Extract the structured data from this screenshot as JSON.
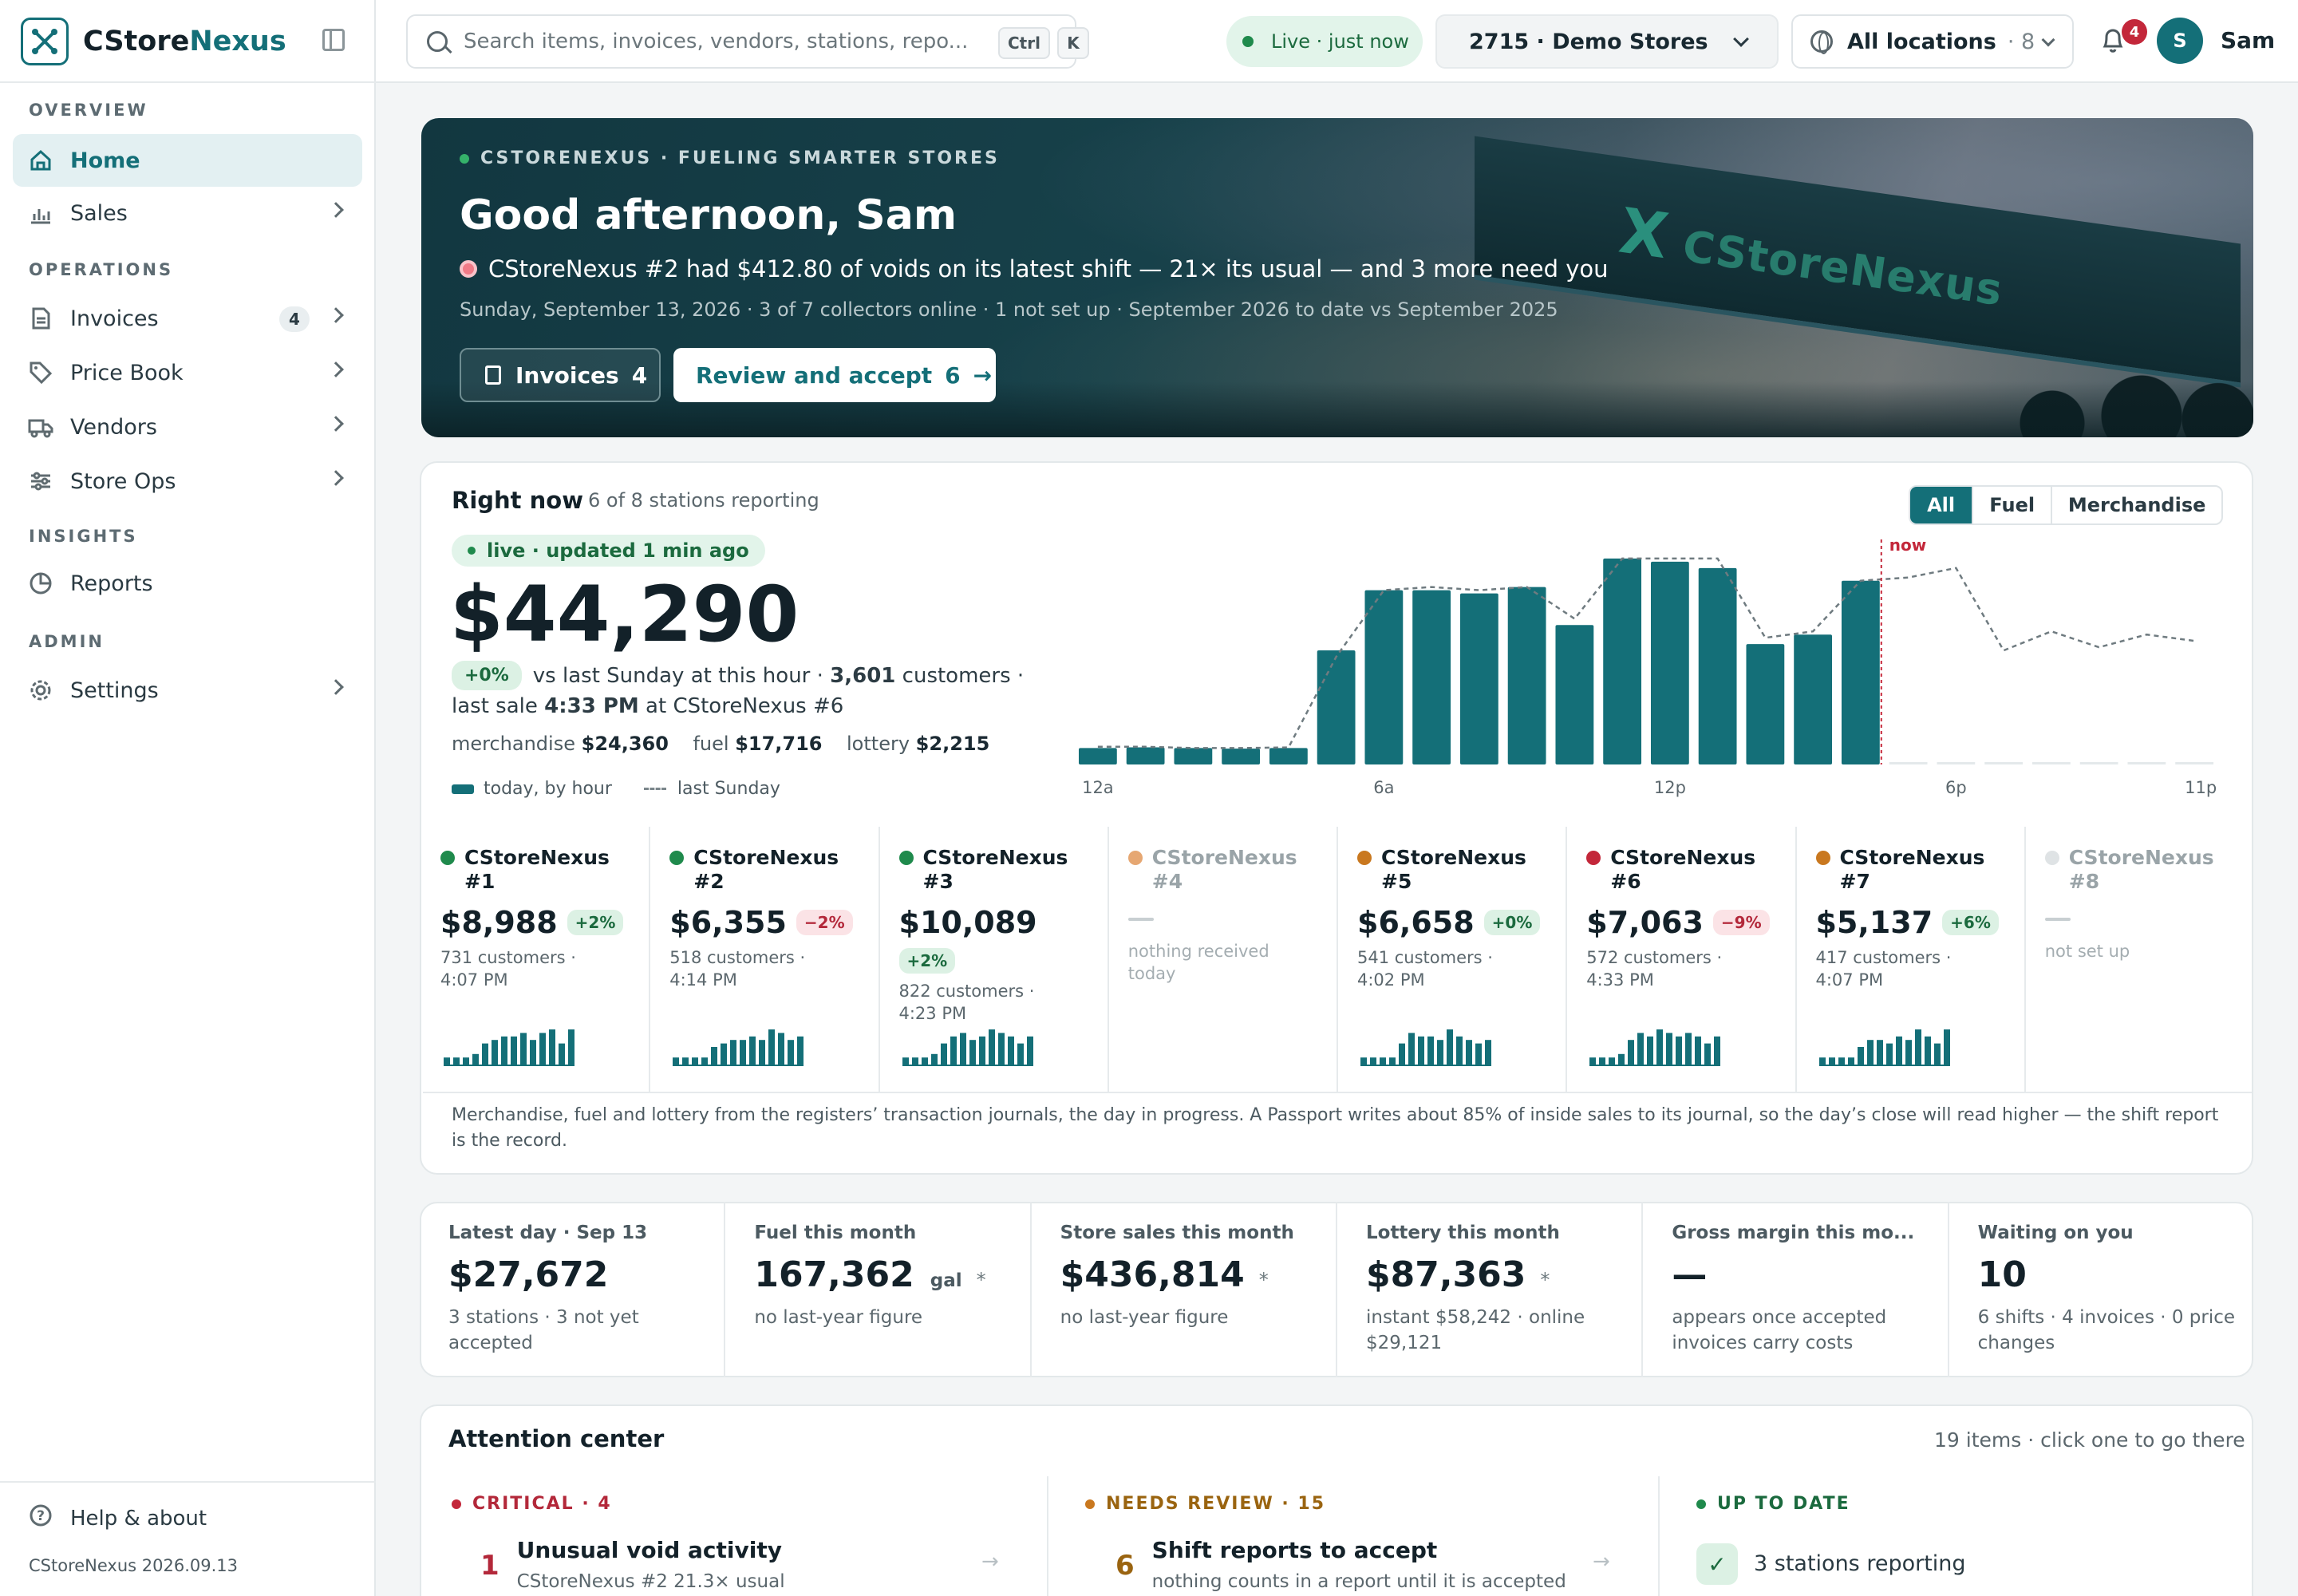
{
  "app": {
    "name_a": "CStore",
    "name_b": "Nexus",
    "version": "CStoreNexus 2026.09.13"
  },
  "sidebar": {
    "sections": {
      "overview": "OVERVIEW",
      "operations": "OPERATIONS",
      "insights": "INSIGHTS",
      "admin": "ADMIN"
    },
    "items": [
      {
        "label": "Home",
        "icon": "home-icon",
        "active": true
      },
      {
        "label": "Sales",
        "icon": "bar-chart-icon"
      },
      {
        "label": "Invoices",
        "icon": "invoice-icon",
        "count": "4"
      },
      {
        "label": "Price Book",
        "icon": "tag-icon"
      },
      {
        "label": "Vendors",
        "icon": "truck-icon"
      },
      {
        "label": "Store Ops",
        "icon": "sliders-icon"
      },
      {
        "label": "Reports",
        "icon": "pie-chart-icon"
      },
      {
        "label": "Settings",
        "icon": "gear-icon"
      }
    ],
    "help": "Help & about"
  },
  "topbar": {
    "search_placeholder": "Search items, invoices, vendors, stations, repo...",
    "kbd_ctrl": "Ctrl",
    "kbd_k": "K",
    "live": "Live · just now",
    "store": "2715 · Demo Stores",
    "locations": "All locations",
    "locations_count": "· 8",
    "notifications": "4",
    "avatar_initial": "S",
    "user": "Sam"
  },
  "hero": {
    "kicker": "CSTORENEXUS · FUELING SMARTER STORES",
    "title": "Good afternoon, Sam",
    "alert": "CStoreNexus #2 had $412.80 of voids on its latest shift — 21× its usual — and 3 more need you",
    "sub": "Sunday, September 13, 2026 · 3 of 7 collectors online · 1 not set up · September 2026 to date vs September 2025",
    "btn_invoices": "Invoices",
    "btn_invoices_count": "4",
    "btn_review": "Review and accept",
    "btn_review_count": "6",
    "canopy_text": "CStoreNexus"
  },
  "right_now": {
    "title": "Right now",
    "sub": "6 of 8 stations reporting",
    "tabs": [
      "All",
      "Fuel",
      "Merchandise"
    ],
    "live_chip": "live · updated 1 min ago",
    "total": "$44,290",
    "delta": "+0%",
    "delta_text": "vs last Sunday at this hour ·",
    "customers": "3,601",
    "customers_label": "customers ·",
    "last_sale_a": "last sale",
    "last_sale_time": "4:33 PM",
    "last_sale_b": "at CStoreNexus #6",
    "merch_label": "merchandise",
    "merch": "$24,360",
    "fuel_label": "fuel",
    "fuel": "$17,716",
    "lottery_label": "lottery",
    "lottery": "$2,215",
    "legend_today": "today, by hour",
    "legend_last": "last Sunday",
    "note": "Merchandise, fuel and lottery from the registers’ transaction journals, the day in progress. A Passport writes about 85% of inside sales to its journal, so the day’s close will read higher — the shift report is the record."
  },
  "chart_data": {
    "type": "bar",
    "x": [
      "12a",
      "1a",
      "2a",
      "3a",
      "4a",
      "5a",
      "6a",
      "7a",
      "8a",
      "9a",
      "10a",
      "11a",
      "12p",
      "1p",
      "2p",
      "3p",
      "4p",
      "5p",
      "6p",
      "7p",
      "8p",
      "9p",
      "10p",
      "11p"
    ],
    "xticks": [
      "12a",
      "6a",
      "12p",
      "6p",
      "11p"
    ],
    "series": [
      {
        "name": "today, by hour",
        "values": [
          260,
          270,
          260,
          250,
          260,
          1800,
          2750,
          2750,
          2700,
          2800,
          2200,
          3250,
          3200,
          3100,
          1900,
          2050,
          2900,
          null,
          null,
          null,
          null,
          null,
          null,
          null
        ]
      },
      {
        "name": "last Sunday",
        "values": [
          280,
          280,
          260,
          260,
          270,
          1700,
          2750,
          2800,
          2750,
          2800,
          2300,
          3250,
          3250,
          3250,
          2000,
          2100,
          2900,
          2950,
          3100,
          1800,
          2100,
          1850,
          2050,
          1950
        ]
      }
    ],
    "marker": "now",
    "marker_index": 16,
    "colors": {
      "today": "#146f78",
      "last": "#6f7b80",
      "marker": "#c3273a"
    }
  },
  "stations": [
    {
      "name": "CStoreNexus #1",
      "status": "#1f8a4c",
      "amount": "$8,988",
      "change": "+2%",
      "dir": "up",
      "meta": "731 customers · 4:07 PM",
      "spark": [
        2,
        2,
        2,
        3,
        6,
        7,
        8,
        8,
        9,
        7,
        9,
        10,
        6,
        10
      ]
    },
    {
      "name": "CStoreNexus #2",
      "status": "#1f8a4c",
      "amount": "$6,355",
      "change": "−2%",
      "dir": "dn",
      "meta": "518 customers · 4:14 PM",
      "spark": [
        2,
        2,
        2,
        2,
        5,
        6,
        7,
        7,
        8,
        7,
        10,
        9,
        7,
        8
      ]
    },
    {
      "name": "CStoreNexus #3",
      "status": "#1f8a4c",
      "amount": "$10,089",
      "change": "+2%",
      "dir": "up",
      "meta": "822 customers · 4:23 PM",
      "spark": [
        2,
        2,
        2,
        3,
        6,
        8,
        9,
        7,
        8,
        10,
        9,
        8,
        6,
        8
      ]
    },
    {
      "name": "CStoreNexus #4",
      "status": "#e6a772",
      "amount": "",
      "change": "",
      "dir": "none",
      "meta": "nothing received today",
      "spark": []
    },
    {
      "name": "CStoreNexus #5",
      "status": "#c9781f",
      "amount": "$6,658",
      "change": "+0%",
      "dir": "up",
      "meta": "541 customers · 4:02 PM",
      "spark": [
        2,
        2,
        2,
        2,
        6,
        9,
        8,
        8,
        7,
        10,
        8,
        7,
        6,
        7
      ]
    },
    {
      "name": "CStoreNexus #6",
      "status": "#c3273a",
      "amount": "$7,063",
      "change": "−9%",
      "dir": "dn",
      "meta": "572 customers · 4:33 PM",
      "spark": [
        2,
        2,
        2,
        3,
        7,
        9,
        8,
        10,
        9,
        8,
        9,
        8,
        6,
        8
      ]
    },
    {
      "name": "CStoreNexus #7",
      "status": "#c9781f",
      "amount": "$5,137",
      "change": "+6%",
      "dir": "up",
      "meta": "417 customers · 4:07 PM",
      "spark": [
        2,
        2,
        2,
        2,
        5,
        7,
        7,
        6,
        8,
        7,
        10,
        8,
        6,
        10
      ]
    },
    {
      "name": "CStoreNexus #8",
      "status": "#dfe3e5",
      "amount": "",
      "change": "",
      "dir": "none",
      "meta": "not set up",
      "spark": []
    }
  ],
  "kpis": [
    {
      "label": "Latest day · Sep 13",
      "value": "$27,672",
      "unit": "",
      "ast": "",
      "sub": "3 stations · 3 not yet accepted"
    },
    {
      "label": "Fuel this month",
      "value": "167,362",
      "unit": "gal",
      "ast": "*",
      "sub": "no last-year figure"
    },
    {
      "label": "Store sales this month",
      "value": "$436,814",
      "unit": "",
      "ast": "*",
      "sub": "no last-year figure"
    },
    {
      "label": "Lottery this month",
      "value": "$87,363",
      "unit": "",
      "ast": "*",
      "sub": "instant $58,242 · online $29,121"
    },
    {
      "label": "Gross margin this mo...",
      "value": "—",
      "unit": "",
      "ast": "",
      "sub": "appears once accepted invoices carry costs"
    },
    {
      "label": "Waiting on you",
      "value": "10",
      "unit": "",
      "ast": "",
      "sub": "6 shifts · 4 invoices · 0 price changes"
    }
  ],
  "attention": {
    "title": "Attention center",
    "sub": "19 items · click one to go there",
    "critical": "CRITICAL · 4",
    "review": "NEEDS REVIEW · 15",
    "uptodate": "UP TO DATE",
    "crit_item": {
      "n": "1",
      "title": "Unusual void activity",
      "desc": "CStoreNexus #2 21.3× usual"
    },
    "rev_item": {
      "n": "6",
      "title": "Shift reports to accept",
      "desc": "nothing counts in a report until it is accepted"
    },
    "ok_item": "3 stations reporting"
  }
}
